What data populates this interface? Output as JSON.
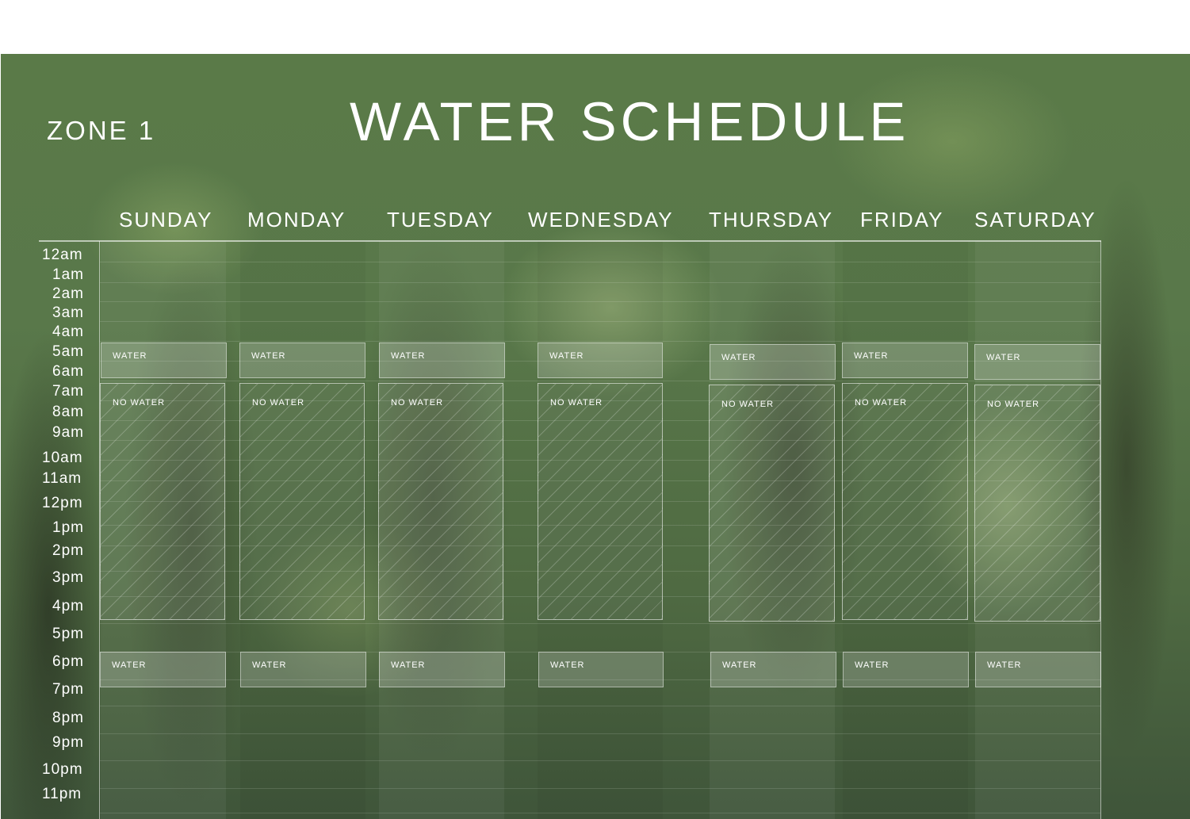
{
  "header": {
    "title": "WATER SCHEDULE",
    "zone": "ZONE 1"
  },
  "days": [
    "SUNDAY",
    "MONDAY",
    "TUESDAY",
    "WEDNESDAY",
    "THURSDAY",
    "FRIDAY",
    "SATURDAY"
  ],
  "times": [
    "12am",
    "1am",
    "2am",
    "3am",
    "4am",
    "5am",
    "6am",
    "7am",
    "8am",
    "9am",
    "10am",
    "11am",
    "12pm",
    "1pm",
    "2pm",
    "3pm",
    "4pm",
    "5pm",
    "6pm",
    "7pm",
    "8pm",
    "9pm",
    "10pm",
    "11pm"
  ],
  "labels": {
    "water": "WATER",
    "no_water": "NO WATER"
  },
  "colors": {
    "text": "#ffffff",
    "grid": "#ffffff",
    "background": "#55744a"
  }
}
